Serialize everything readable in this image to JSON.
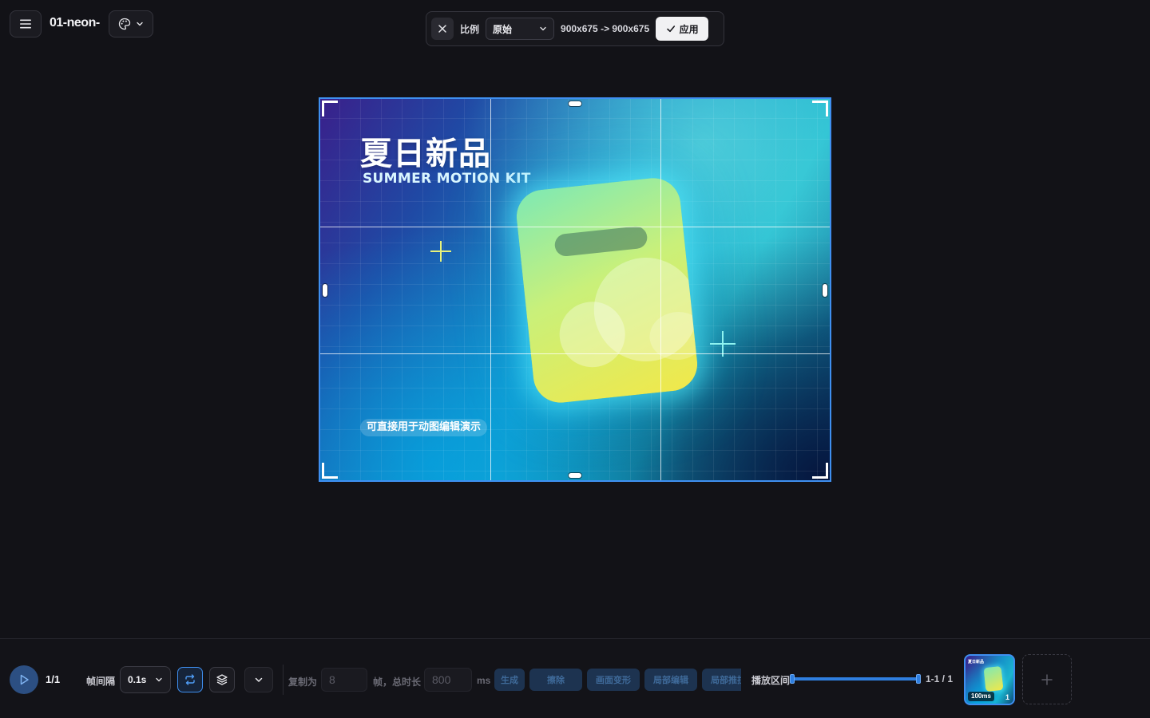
{
  "header": {
    "menu_icon": "hamburger-icon",
    "file_title": "01-neon-",
    "theme_icon": "palette-icon"
  },
  "crop_toolbar": {
    "ratio_label": "比例",
    "ratio_value": "原始",
    "size_text": "900x675 -> 900x675",
    "apply_label": "应用"
  },
  "artwork": {
    "title": "夏日新品",
    "subtitle": "SUMMER MOTION KIT",
    "badge": "可直接用于动图编辑演示"
  },
  "timeline": {
    "frame_counter": "1/1",
    "interval_label": "帧间隔",
    "interval_value": "0.1s",
    "copy_label": "复制为",
    "copy_count_placeholder": "8",
    "frames_total_label": "帧，总时长",
    "duration_placeholder": "800",
    "ms_label": "ms",
    "actions": {
      "generate": "生成",
      "erase": "擦除",
      "transform": "画面变形",
      "local_edit": "局部编辑",
      "local_push": "局部推拉"
    },
    "range_label": "播放区间",
    "range_text": "1-1 / 1",
    "thumbnail": {
      "duration": "100ms",
      "index": "1",
      "title": "夏日新品"
    }
  },
  "colors": {
    "accent": "#3f8ff0",
    "background": "#121217",
    "apply_button": "#f1f1f3"
  }
}
